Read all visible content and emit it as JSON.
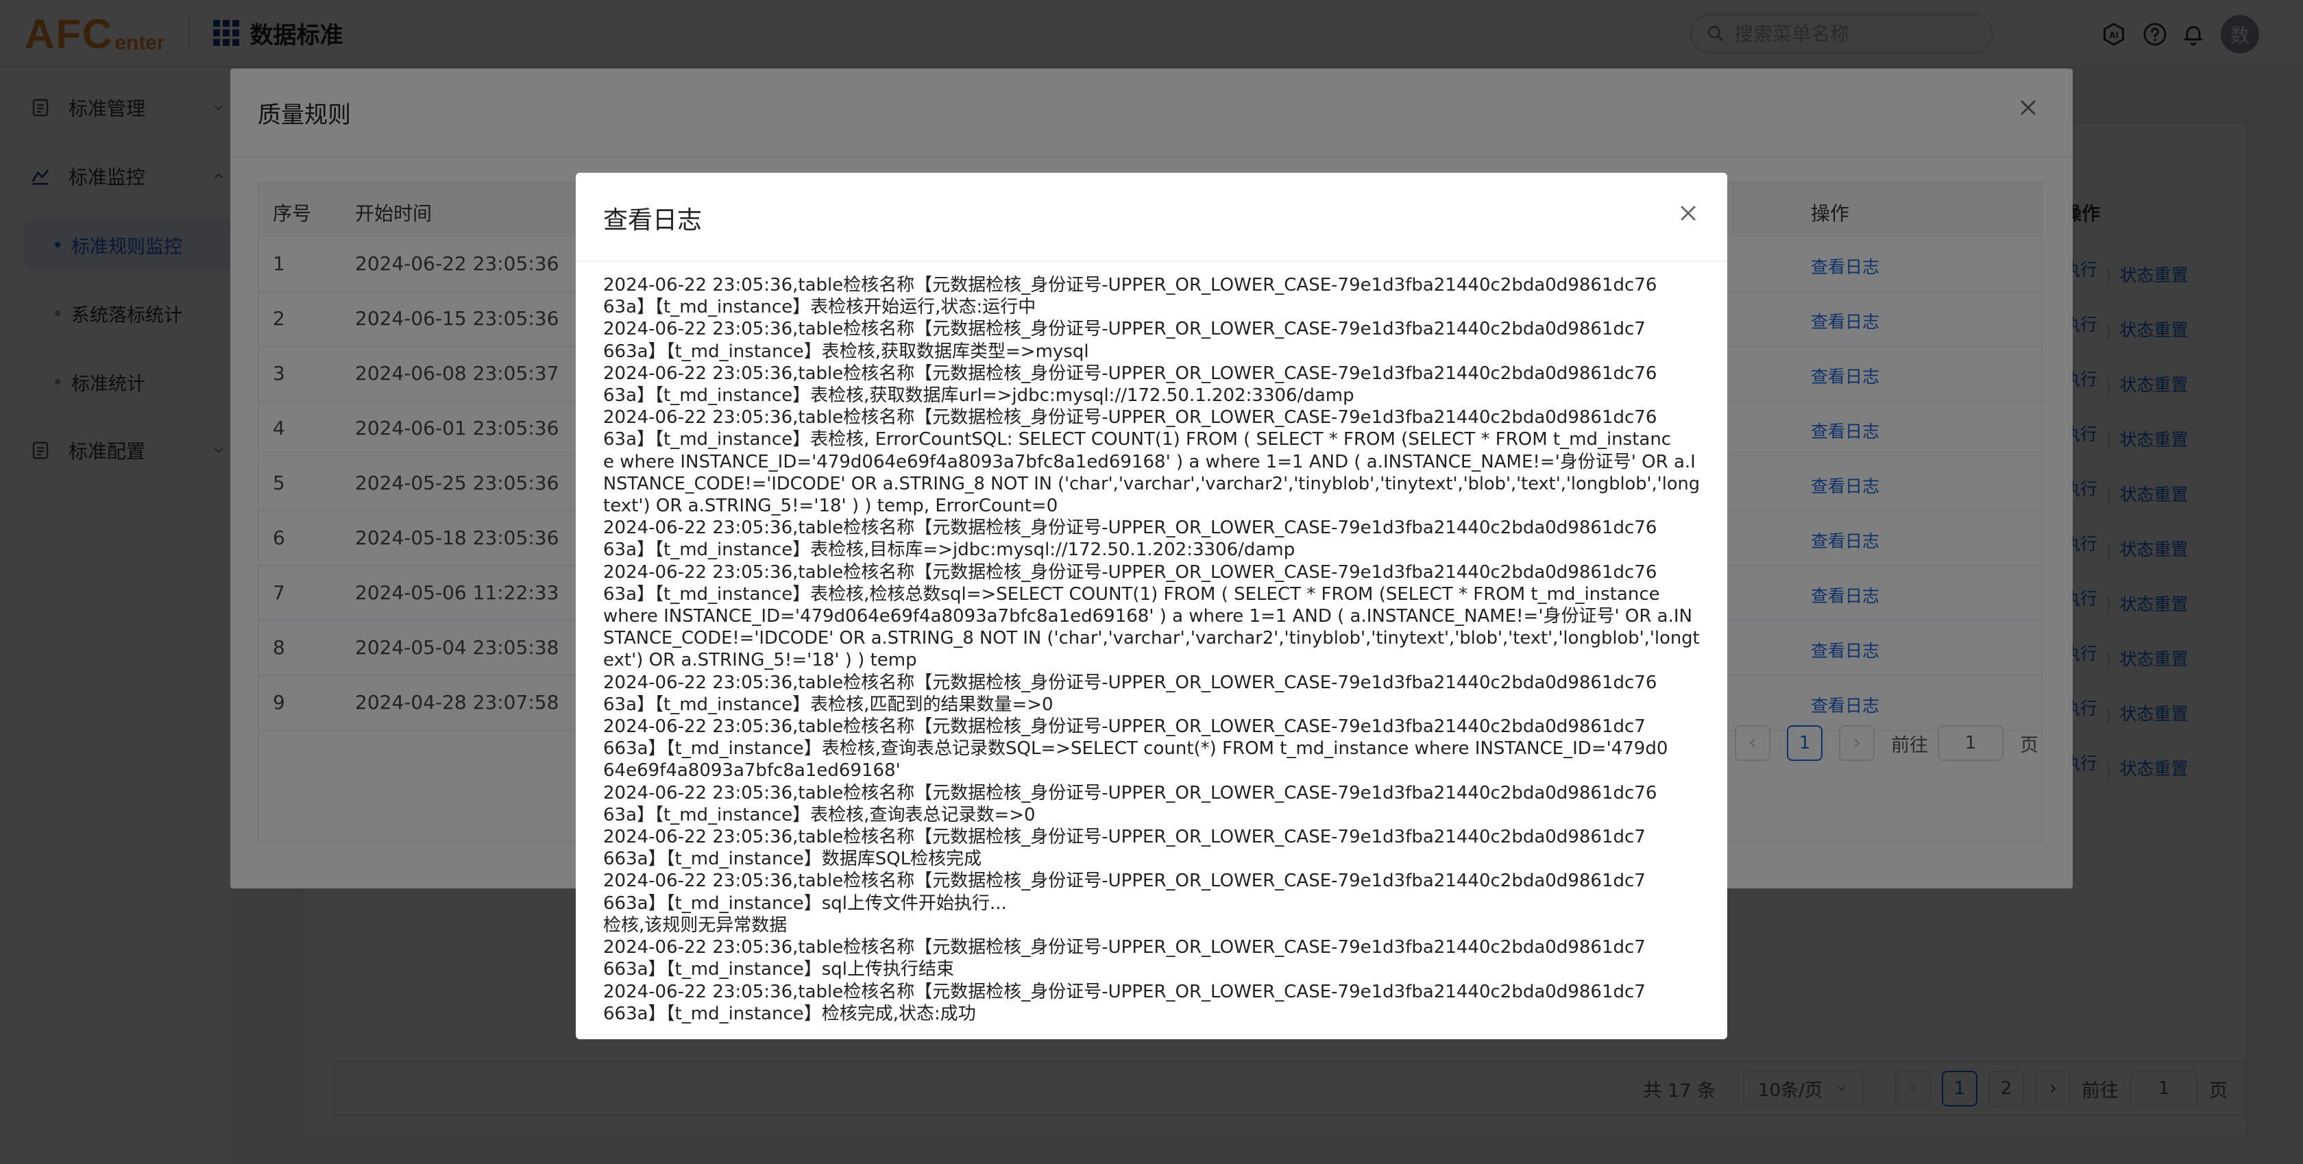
{
  "header": {
    "logo_main": "AFC",
    "logo_sub": "enter",
    "app_title": "数据标准",
    "search_placeholder": "搜索菜单名称",
    "avatar_text": "数"
  },
  "sidebar": {
    "groups": [
      {
        "label": "标准管理"
      },
      {
        "label": "标准监控"
      },
      {
        "label": "标准配置"
      }
    ],
    "sub_items": [
      {
        "label": "标准规则监控"
      },
      {
        "label": "系统落标统计"
      },
      {
        "label": "标准统计"
      }
    ]
  },
  "background": {
    "ops_header": "操作",
    "op_execute": "执行",
    "op_reset": "状态重置",
    "total": "共 17 条",
    "page_size": "10条/页",
    "pages": [
      "1",
      "2"
    ],
    "goto_label": "前往",
    "goto_value": "1",
    "page_unit": "页"
  },
  "quality_dialog": {
    "title": "质量规则",
    "columns": {
      "index": "序号",
      "start_time": "开始时间",
      "ops": "操作"
    },
    "rows": [
      {
        "index": "1",
        "start_time": "2024-06-22 23:05:36",
        "op": "查看日志"
      },
      {
        "index": "2",
        "start_time": "2024-06-15 23:05:36",
        "op": "查看日志"
      },
      {
        "index": "3",
        "start_time": "2024-06-08 23:05:37",
        "op": "查看日志"
      },
      {
        "index": "4",
        "start_time": "2024-06-01 23:05:36",
        "op": "查看日志"
      },
      {
        "index": "5",
        "start_time": "2024-05-25 23:05:36",
        "op": "查看日志"
      },
      {
        "index": "6",
        "start_time": "2024-05-18 23:05:36",
        "op": "查看日志"
      },
      {
        "index": "7",
        "start_time": "2024-05-06 11:22:33",
        "op": "查看日志"
      },
      {
        "index": "8",
        "start_time": "2024-05-04 23:05:38",
        "op": "查看日志"
      },
      {
        "index": "9",
        "start_time": "2024-04-28 23:07:58",
        "op": "查看日志"
      }
    ],
    "pager": {
      "page": "1",
      "goto_label": "前往",
      "goto_value": "1",
      "page_unit": "页"
    }
  },
  "log_dialog": {
    "title": "查看日志",
    "lines": [
      "2024-06-22 23:05:36,table检核名称【元数据检核_身份证号-UPPER_OR_LOWER_CASE-79e1d3fba21440c2bda0d9861dc76",
      "63a】【t_md_instance】表检核开始运行,状态:运行中",
      "2024-06-22 23:05:36,table检核名称【元数据检核_身份证号-UPPER_OR_LOWER_CASE-79e1d3fba21440c2bda0d9861dc7",
      "663a】【t_md_instance】表检核,获取数据库类型=>mysql",
      "2024-06-22 23:05:36,table检核名称【元数据检核_身份证号-UPPER_OR_LOWER_CASE-79e1d3fba21440c2bda0d9861dc76",
      "63a】【t_md_instance】表检核,获取数据库url=>jdbc:mysql://172.50.1.202:3306/damp",
      "2024-06-22 23:05:36,table检核名称【元数据检核_身份证号-UPPER_OR_LOWER_CASE-79e1d3fba21440c2bda0d9861dc76",
      "63a】【t_md_instance】表检核, ErrorCountSQL: SELECT COUNT(1) FROM ( SELECT * FROM (SELECT * FROM t_md_instanc",
      "e where INSTANCE_ID='479d064e69f4a8093a7bfc8a1ed69168' ) a where 1=1 AND ( a.INSTANCE_NAME!='身份证号' OR a.I",
      "NSTANCE_CODE!='IDCODE' OR a.STRING_8 NOT IN ('char','varchar','varchar2','tinyblob','tinytext','blob','text','longblob','long",
      "text') OR a.STRING_5!='18' ) ) temp, ErrorCount=0",
      "2024-06-22 23:05:36,table检核名称【元数据检核_身份证号-UPPER_OR_LOWER_CASE-79e1d3fba21440c2bda0d9861dc76",
      "63a】【t_md_instance】表检核,目标库=>jdbc:mysql://172.50.1.202:3306/damp",
      "2024-06-22 23:05:36,table检核名称【元数据检核_身份证号-UPPER_OR_LOWER_CASE-79e1d3fba21440c2bda0d9861dc76",
      "63a】【t_md_instance】表检核,检核总数sql=>SELECT COUNT(1) FROM ( SELECT * FROM (SELECT * FROM t_md_instance",
      "where INSTANCE_ID='479d064e69f4a8093a7bfc8a1ed69168' ) a where 1=1 AND ( a.INSTANCE_NAME!='身份证号' OR a.IN",
      "STANCE_CODE!='IDCODE' OR a.STRING_8 NOT IN ('char','varchar','varchar2','tinyblob','tinytext','blob','text','longblob','longt",
      "ext') OR a.STRING_5!='18' ) ) temp",
      "2024-06-22 23:05:36,table检核名称【元数据检核_身份证号-UPPER_OR_LOWER_CASE-79e1d3fba21440c2bda0d9861dc76",
      "63a】【t_md_instance】表检核,匹配到的结果数量=>0",
      "2024-06-22 23:05:36,table检核名称【元数据检核_身份证号-UPPER_OR_LOWER_CASE-79e1d3fba21440c2bda0d9861dc7",
      "663a】【t_md_instance】表检核,查询表总记录数SQL=>SELECT count(*) FROM t_md_instance where INSTANCE_ID='479d0",
      "64e69f4a8093a7bfc8a1ed69168'",
      "2024-06-22 23:05:36,table检核名称【元数据检核_身份证号-UPPER_OR_LOWER_CASE-79e1d3fba21440c2bda0d9861dc76",
      "63a】【t_md_instance】表检核,查询表总记录数=>0",
      "2024-06-22 23:05:36,table检核名称【元数据检核_身份证号-UPPER_OR_LOWER_CASE-79e1d3fba21440c2bda0d9861dc7",
      "663a】【t_md_instance】数据库SQL检核完成",
      "2024-06-22 23:05:36,table检核名称【元数据检核_身份证号-UPPER_OR_LOWER_CASE-79e1d3fba21440c2bda0d9861dc7",
      "663a】【t_md_instance】sql上传文件开始执行...",
      "检核,该规则无异常数据",
      "2024-06-22 23:05:36,table检核名称【元数据检核_身份证号-UPPER_OR_LOWER_CASE-79e1d3fba21440c2bda0d9861dc7",
      "663a】【t_md_instance】sql上传执行结束",
      "2024-06-22 23:05:36,table检核名称【元数据检核_身份证号-UPPER_OR_LOWER_CASE-79e1d3fba21440c2bda0d9861dc7",
      "663a】【t_md_instance】检核完成,状态:成功"
    ]
  },
  "colors": {
    "accent": "#1f62d6",
    "logo": "#e08a2c",
    "overlay": "rgba(0,0,0,0.5)"
  },
  "icons": [
    "grid-icon",
    "search-icon",
    "ai-icon",
    "help-icon",
    "bell-icon",
    "list-icon",
    "monitor-icon",
    "chevron-down-icon",
    "chevron-up-icon",
    "close-icon",
    "chevron-left-icon",
    "chevron-right-icon"
  ]
}
